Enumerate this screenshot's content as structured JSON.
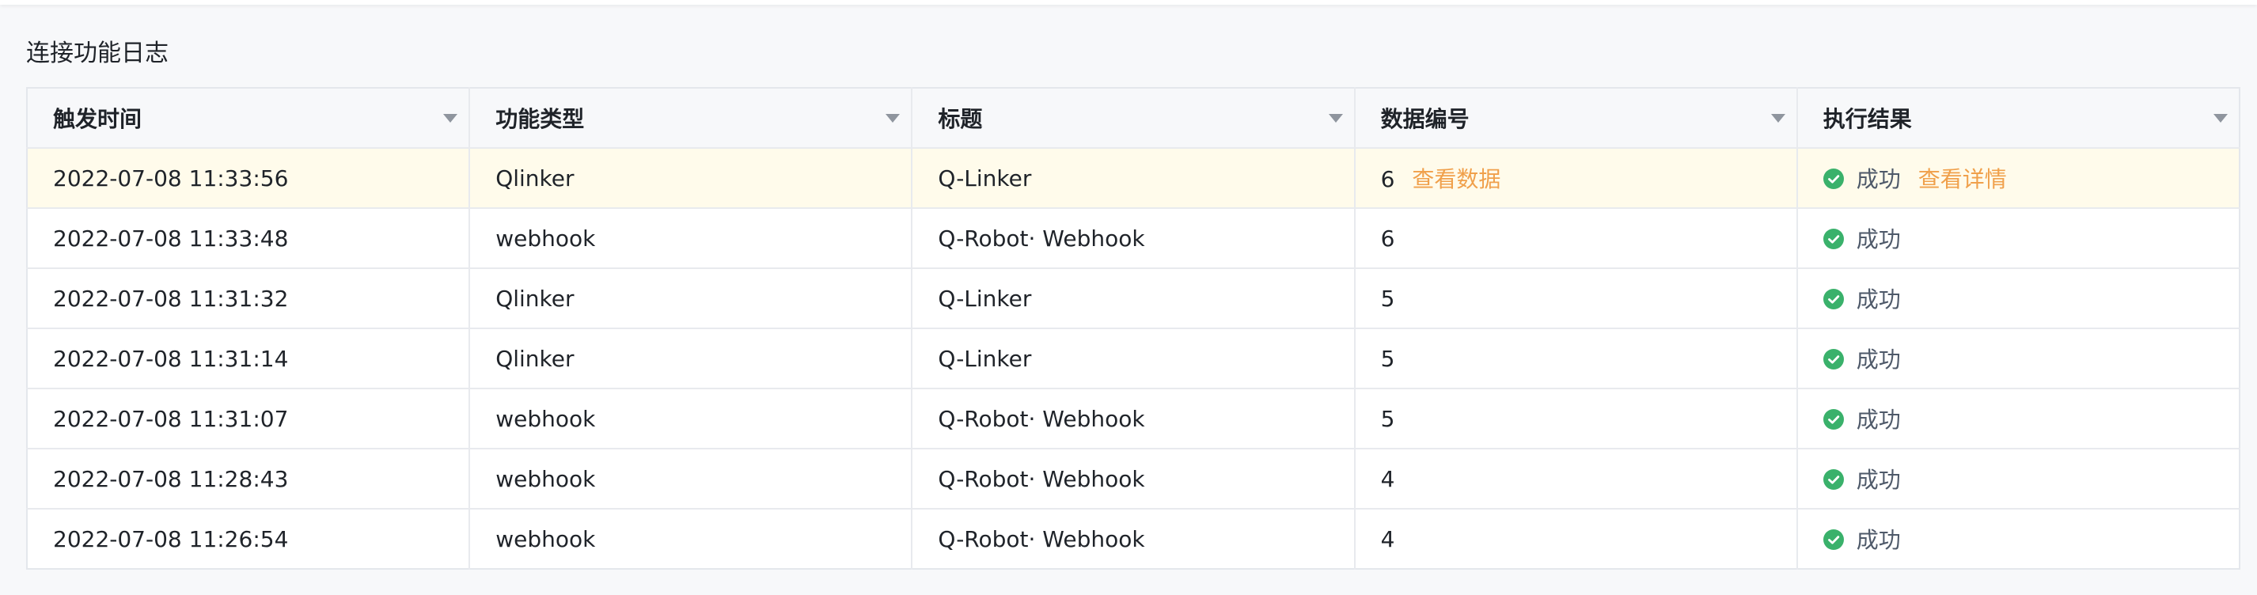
{
  "section_title": "连接功能日志",
  "columns": [
    "触发时间",
    "功能类型",
    "标题",
    "数据编号",
    "执行结果"
  ],
  "rows": [
    {
      "time": "2022-07-08 11:33:56",
      "type": "Qlinker",
      "title": "Q-Linker",
      "data_no": "6",
      "data_link": "查看数据",
      "result": "成功",
      "detail_link": "查看详情"
    },
    {
      "time": "2022-07-08 11:33:48",
      "type": "webhook",
      "title": "Q-Robot· Webhook",
      "data_no": "6",
      "data_link": "",
      "result": "成功",
      "detail_link": ""
    },
    {
      "time": "2022-07-08 11:31:32",
      "type": "Qlinker",
      "title": "Q-Linker",
      "data_no": "5",
      "data_link": "",
      "result": "成功",
      "detail_link": ""
    },
    {
      "time": "2022-07-08 11:31:14",
      "type": "Qlinker",
      "title": "Q-Linker",
      "data_no": "5",
      "data_link": "",
      "result": "成功",
      "detail_link": ""
    },
    {
      "time": "2022-07-08 11:31:07",
      "type": "webhook",
      "title": "Q-Robot· Webhook",
      "data_no": "5",
      "data_link": "",
      "result": "成功",
      "detail_link": ""
    },
    {
      "time": "2022-07-08 11:28:43",
      "type": "webhook",
      "title": "Q-Robot· Webhook",
      "data_no": "4",
      "data_link": "",
      "result": "成功",
      "detail_link": ""
    },
    {
      "time": "2022-07-08 11:26:54",
      "type": "webhook",
      "title": "Q-Robot· Webhook",
      "data_no": "4",
      "data_link": "",
      "result": "成功",
      "detail_link": ""
    }
  ],
  "colors": {
    "accent_link": "#f0a04b",
    "success": "#3ab16b",
    "highlight_row": "#fffbeb"
  },
  "icons": {
    "sort": "sort-caret-down-icon",
    "status": "success-check-icon"
  }
}
